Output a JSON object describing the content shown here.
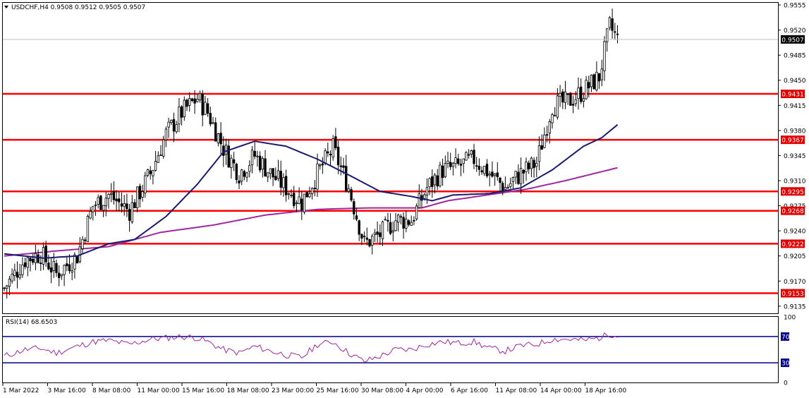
{
  "header": {
    "symbol_text": "USDCHF,H4  0.9508 0.9512 0.9505 0.9507"
  },
  "rsi_header": {
    "text": "RSI(14) 68.6503"
  },
  "colors": {
    "candles": "#000000",
    "ma_fast": "#1a1a6e",
    "ma_slow": "#a0289e",
    "level_lines": "#ff0000",
    "level_label_bg": "#e00000",
    "rsi_line": "#a0289e",
    "rsi_levels": "#00008b",
    "price_label_bg": "#000000"
  },
  "chart_data": [
    {
      "type": "candlestick",
      "symbol": "USDCHF",
      "timeframe": "H4",
      "ohlc_current": {
        "open": 0.9508,
        "high": 0.9512,
        "low": 0.9505,
        "close": 0.9507
      },
      "y_ticks": [
        "0.9555",
        "0.9520",
        "0.9485",
        "0.9450",
        "0.9415",
        "0.9380",
        "0.9345",
        "0.9310",
        "0.9275",
        "0.9240",
        "0.9205",
        "0.9170",
        "0.9135"
      ],
      "ylim": [
        0.9125,
        0.9558
      ],
      "x_ticks": [
        "1 Mar 2022",
        "3 Mar 16:00",
        "8 Mar 08:00",
        "11 Mar 00:00",
        "15 Mar 16:00",
        "18 Mar 08:00",
        "23 Mar 00:00",
        "25 Mar 16:00",
        "30 Mar 08:00",
        "4 Apr 00:00",
        "6 Apr 16:00",
        "11 Apr 08:00",
        "14 Apr 00:00",
        "18 Apr 16:00"
      ],
      "current_price_label": "0.9507",
      "horizontal_levels": [
        "0.9431",
        "0.9367",
        "0.9295",
        "0.9268",
        "0.9222",
        "0.9153"
      ],
      "close_path": [
        {
          "i": 0,
          "v": 0.916
        },
        {
          "i": 8,
          "v": 0.92
        },
        {
          "i": 14,
          "v": 0.9208
        },
        {
          "i": 20,
          "v": 0.918
        },
        {
          "i": 28,
          "v": 0.9205
        },
        {
          "i": 34,
          "v": 0.9275
        },
        {
          "i": 40,
          "v": 0.929
        },
        {
          "i": 48,
          "v": 0.9268
        },
        {
          "i": 56,
          "v": 0.932
        },
        {
          "i": 62,
          "v": 0.9375
        },
        {
          "i": 68,
          "v": 0.9405
        },
        {
          "i": 74,
          "v": 0.9425
        },
        {
          "i": 78,
          "v": 0.9405
        },
        {
          "i": 84,
          "v": 0.9355
        },
        {
          "i": 90,
          "v": 0.932
        },
        {
          "i": 96,
          "v": 0.9345
        },
        {
          "i": 102,
          "v": 0.932
        },
        {
          "i": 108,
          "v": 0.93
        },
        {
          "i": 114,
          "v": 0.928
        },
        {
          "i": 120,
          "v": 0.932
        },
        {
          "i": 126,
          "v": 0.9355
        },
        {
          "i": 132,
          "v": 0.93
        },
        {
          "i": 138,
          "v": 0.9222
        },
        {
          "i": 144,
          "v": 0.9235
        },
        {
          "i": 150,
          "v": 0.9255
        },
        {
          "i": 156,
          "v": 0.9255
        },
        {
          "i": 162,
          "v": 0.93
        },
        {
          "i": 168,
          "v": 0.9325
        },
        {
          "i": 174,
          "v": 0.933
        },
        {
          "i": 180,
          "v": 0.934
        },
        {
          "i": 186,
          "v": 0.932
        },
        {
          "i": 192,
          "v": 0.93
        },
        {
          "i": 198,
          "v": 0.932
        },
        {
          "i": 204,
          "v": 0.9335
        },
        {
          "i": 210,
          "v": 0.9415
        },
        {
          "i": 216,
          "v": 0.942
        },
        {
          "i": 222,
          "v": 0.9435
        },
        {
          "i": 228,
          "v": 0.9455
        },
        {
          "i": 232,
          "v": 0.9525
        },
        {
          "i": 235,
          "v": 0.9507
        }
      ],
      "ma_fast": [
        {
          "i": 0,
          "v": 0.9208
        },
        {
          "i": 15,
          "v": 0.9202
        },
        {
          "i": 28,
          "v": 0.9205
        },
        {
          "i": 40,
          "v": 0.9222
        },
        {
          "i": 50,
          "v": 0.9228
        },
        {
          "i": 62,
          "v": 0.926
        },
        {
          "i": 74,
          "v": 0.9305
        },
        {
          "i": 84,
          "v": 0.935
        },
        {
          "i": 96,
          "v": 0.9365
        },
        {
          "i": 108,
          "v": 0.9358
        },
        {
          "i": 120,
          "v": 0.934
        },
        {
          "i": 132,
          "v": 0.9318
        },
        {
          "i": 144,
          "v": 0.9295
        },
        {
          "i": 156,
          "v": 0.9288
        },
        {
          "i": 164,
          "v": 0.9282
        },
        {
          "i": 172,
          "v": 0.929
        },
        {
          "i": 186,
          "v": 0.9292
        },
        {
          "i": 198,
          "v": 0.93
        },
        {
          "i": 210,
          "v": 0.9325
        },
        {
          "i": 222,
          "v": 0.9358
        },
        {
          "i": 229,
          "v": 0.937
        },
        {
          "i": 235,
          "v": 0.9388
        }
      ],
      "ma_slow": [
        {
          "i": 0,
          "v": 0.9205
        },
        {
          "i": 20,
          "v": 0.9212
        },
        {
          "i": 40,
          "v": 0.9218
        },
        {
          "i": 60,
          "v": 0.9238
        },
        {
          "i": 80,
          "v": 0.9248
        },
        {
          "i": 100,
          "v": 0.9262
        },
        {
          "i": 120,
          "v": 0.927
        },
        {
          "i": 140,
          "v": 0.9272
        },
        {
          "i": 160,
          "v": 0.9272
        },
        {
          "i": 170,
          "v": 0.9282
        },
        {
          "i": 185,
          "v": 0.929
        },
        {
          "i": 200,
          "v": 0.9298
        },
        {
          "i": 215,
          "v": 0.931
        },
        {
          "i": 235,
          "v": 0.9328
        }
      ]
    },
    {
      "type": "line",
      "title": "RSI(14) 68.6503",
      "y_ticks": [
        "100",
        "70",
        "30",
        "0"
      ],
      "ylim": [
        0,
        100
      ],
      "levels": [
        70,
        30
      ],
      "current_value": 68.6503,
      "path": [
        {
          "i": 0,
          "v": 40
        },
        {
          "i": 8,
          "v": 50
        },
        {
          "i": 14,
          "v": 52
        },
        {
          "i": 20,
          "v": 45
        },
        {
          "i": 28,
          "v": 55
        },
        {
          "i": 34,
          "v": 62
        },
        {
          "i": 40,
          "v": 64
        },
        {
          "i": 48,
          "v": 58
        },
        {
          "i": 56,
          "v": 66
        },
        {
          "i": 62,
          "v": 68
        },
        {
          "i": 68,
          "v": 70
        },
        {
          "i": 74,
          "v": 68
        },
        {
          "i": 78,
          "v": 62
        },
        {
          "i": 84,
          "v": 50
        },
        {
          "i": 90,
          "v": 45
        },
        {
          "i": 96,
          "v": 55
        },
        {
          "i": 102,
          "v": 48
        },
        {
          "i": 108,
          "v": 42
        },
        {
          "i": 114,
          "v": 38
        },
        {
          "i": 120,
          "v": 58
        },
        {
          "i": 126,
          "v": 62
        },
        {
          "i": 132,
          "v": 45
        },
        {
          "i": 138,
          "v": 32
        },
        {
          "i": 144,
          "v": 40
        },
        {
          "i": 150,
          "v": 50
        },
        {
          "i": 156,
          "v": 50
        },
        {
          "i": 162,
          "v": 58
        },
        {
          "i": 168,
          "v": 62
        },
        {
          "i": 174,
          "v": 60
        },
        {
          "i": 180,
          "v": 62
        },
        {
          "i": 186,
          "v": 52
        },
        {
          "i": 192,
          "v": 48
        },
        {
          "i": 198,
          "v": 56
        },
        {
          "i": 204,
          "v": 58
        },
        {
          "i": 210,
          "v": 66
        },
        {
          "i": 216,
          "v": 66
        },
        {
          "i": 222,
          "v": 64
        },
        {
          "i": 228,
          "v": 68
        },
        {
          "i": 232,
          "v": 74
        },
        {
          "i": 235,
          "v": 68.65
        }
      ]
    }
  ]
}
